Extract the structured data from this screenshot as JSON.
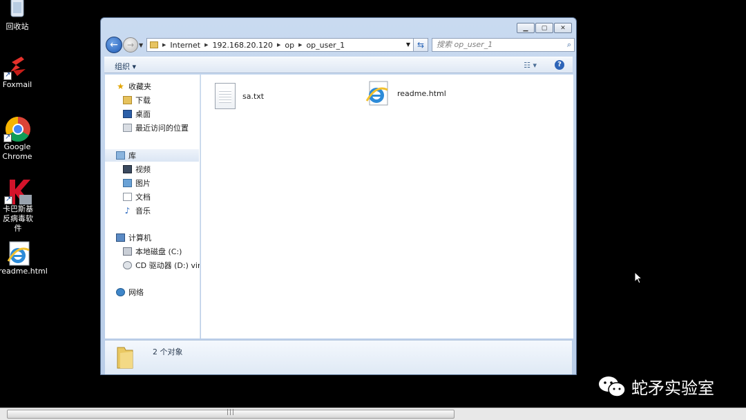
{
  "desktop": {
    "icons": [
      {
        "label": "回收站",
        "icon": "recycle-bin-icon"
      },
      {
        "label": "Foxmail",
        "icon": "foxmail-icon"
      },
      {
        "label": "Google Chrome",
        "icon": "chrome-icon"
      },
      {
        "label": "卡巴斯基反病毒软件",
        "icon": "kaspersky-icon"
      },
      {
        "label": "readme.html",
        "icon": "ie-icon"
      }
    ]
  },
  "window": {
    "address": {
      "crumbs": [
        "Internet",
        "192.168.20.120",
        "op",
        "op_user_1"
      ]
    },
    "search": {
      "placeholder": "搜索 op_user_1"
    },
    "toolbar": {
      "organize_label": "组织 ▾"
    },
    "nav": {
      "favorites": {
        "label": "收藏夹",
        "items": [
          "下载",
          "桌面",
          "最近访问的位置"
        ]
      },
      "libraries": {
        "label": "库",
        "items": [
          "视频",
          "图片",
          "文档",
          "音乐"
        ]
      },
      "computer": {
        "label": "计算机",
        "items": [
          "本地磁盘 (C:)",
          "CD 驱动器 (D:) virti"
        ]
      },
      "network": {
        "label": "网络"
      }
    },
    "files": [
      {
        "name": "sa.txt",
        "icon": "text-file-icon"
      },
      {
        "name": "readme.html",
        "icon": "ie-icon"
      }
    ],
    "status": {
      "count_text": "2 个对象"
    }
  },
  "watermark": {
    "text": "蛇矛实验室"
  },
  "colors": {
    "accent": "#2763b6",
    "window_frame": "#c9daf0",
    "desktop": "#000000"
  }
}
